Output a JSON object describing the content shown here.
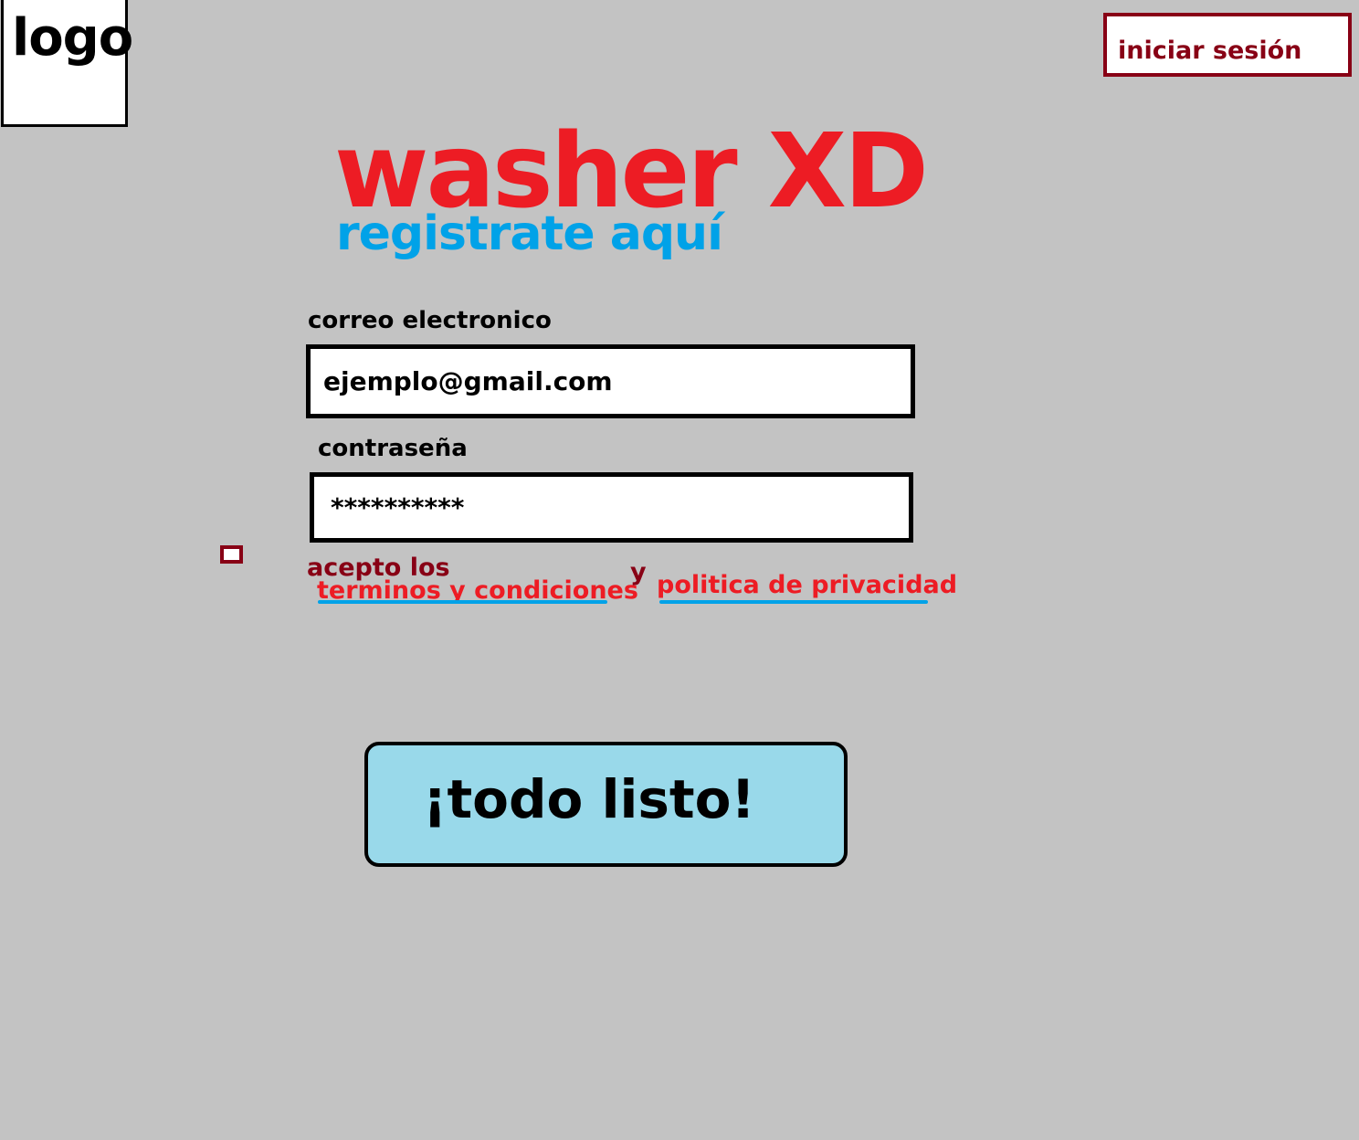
{
  "header": {
    "logo_text": "logo",
    "login_label": "iniciar sesión"
  },
  "hero": {
    "title": "washer XD",
    "subtitle": "registrate aquí"
  },
  "form": {
    "email": {
      "label": "correo electronico",
      "value": "ejemplo@gmail.com"
    },
    "password": {
      "label": "contraseña",
      "value": "**********"
    },
    "consent": {
      "checked": false,
      "accept_text": "acepto los",
      "terms_link": "terminos y condiciones",
      "and_text": "y",
      "privacy_link": "politica de privacidad"
    },
    "submit_label": "¡todo listo!"
  },
  "colors": {
    "background": "#c3c3c3",
    "brand_red": "#ed1c24",
    "subtitle_blue": "#00a2e8",
    "dark_red": "#880015",
    "button_fill": "#99d9ea"
  }
}
